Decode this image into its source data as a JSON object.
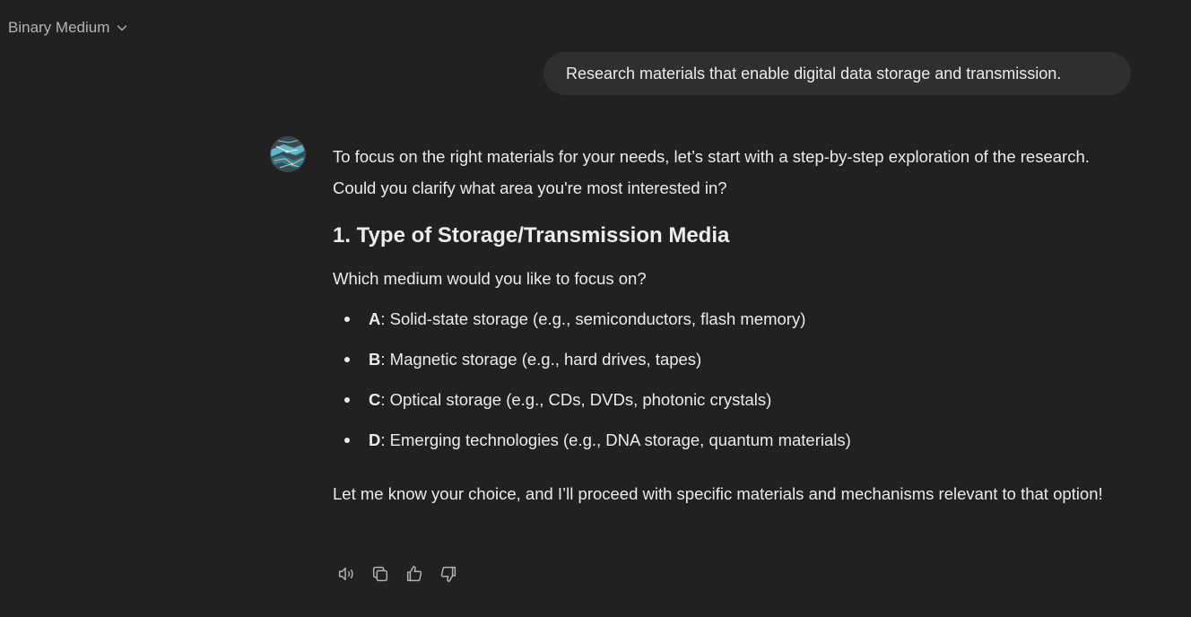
{
  "header": {
    "model_name": "Binary Medium"
  },
  "user_message": {
    "text": "Research materials that enable digital data storage and transmission."
  },
  "assistant": {
    "intro": "To focus on the right materials for your needs, let’s start with a step-by-step exploration of the research. Could you clarify what area you're most interested in?",
    "heading": "1. Type of Storage/Transmission Media",
    "question": "Which medium would you like to focus on?",
    "options": [
      {
        "letter": "A",
        "text": ": Solid-state storage (e.g., semiconductors, flash memory)"
      },
      {
        "letter": "B",
        "text": ": Magnetic storage (e.g., hard drives, tapes)"
      },
      {
        "letter": "C",
        "text": ": Optical storage (e.g., CDs, DVDs, photonic crystals)"
      },
      {
        "letter": "D",
        "text": ": Emerging technologies (e.g., DNA storage, quantum materials)"
      }
    ],
    "closing": "Let me know your choice, and I’ll proceed with specific materials and mechanisms relevant to that option!"
  },
  "actions": {
    "icons": [
      "read-aloud-icon",
      "copy-icon",
      "thumbs-up-icon",
      "thumbs-down-icon"
    ]
  },
  "colors": {
    "background": "#212121",
    "bubble": "#2f2f2f",
    "text": "#ececec",
    "muted": "#b4b4b4"
  }
}
